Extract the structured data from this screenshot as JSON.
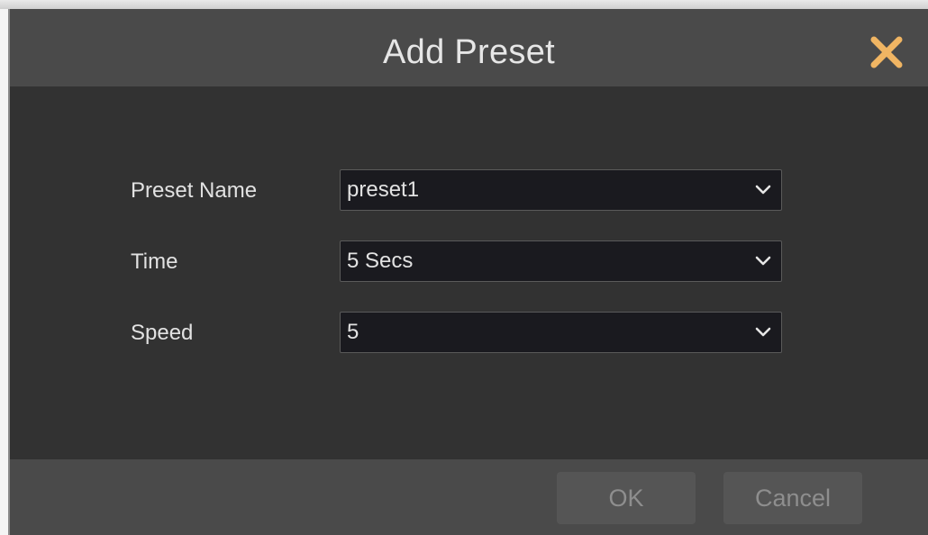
{
  "dialog": {
    "title": "Add Preset",
    "close_icon": "close-x-icon",
    "accent_color": "#f0b563"
  },
  "fields": [
    {
      "label": "Preset Name",
      "value": "preset1",
      "icon": "chevron-down-icon"
    },
    {
      "label": "Time",
      "value": "5 Secs",
      "icon": "chevron-down-icon"
    },
    {
      "label": "Speed",
      "value": "5",
      "icon": "chevron-down-icon"
    }
  ],
  "footer": {
    "ok_label": "OK",
    "cancel_label": "Cancel"
  }
}
